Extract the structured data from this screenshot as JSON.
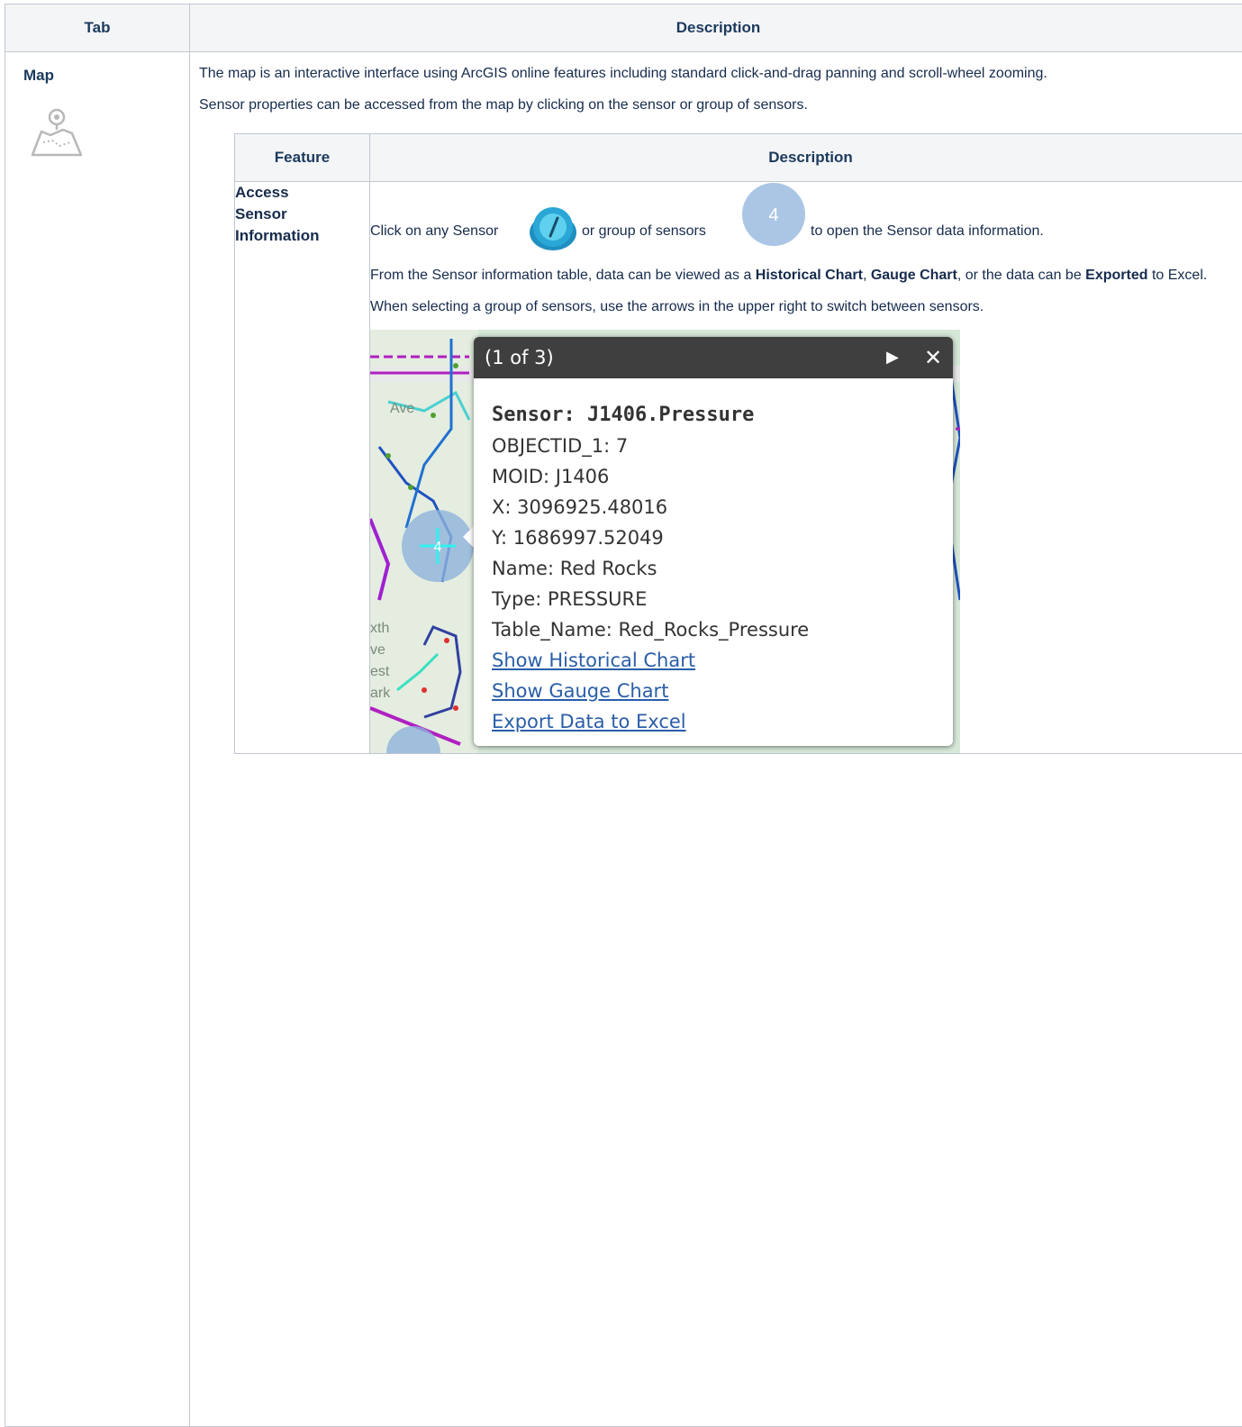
{
  "outer_table": {
    "headers": [
      "Tab",
      "Description"
    ],
    "tab_name": "Map",
    "tab_icon": "map-pin-icon",
    "p1": "The map is an interactive interface using ArcGIS online features including standard click-and-drag panning and scroll-wheel zooming.",
    "p2": "Sensor properties can be accessed from the map by clicking on the sensor or group of sensors."
  },
  "inner_table": {
    "headers": [
      "Feature",
      "Description"
    ],
    "feature_label": "Access Sensor Information",
    "click_line": {
      "part1": "Click on any Sensor",
      "part2": "or group of sensors",
      "part3": "to open the Sensor data information."
    },
    "cluster_count": "4",
    "s2": {
      "a": "From the Sensor information table, data can be viewed as a ",
      "b1": "Historical Chart",
      "c": ", ",
      "b2": "Gauge Chart",
      "d": ", or the data can be ",
      "b3": "Exported",
      "e": " to Excel."
    },
    "s3": "When selecting a group of sensors, use the arrows in the upper right to switch between sensors."
  },
  "popup": {
    "title": "(1 of 3)",
    "next_icon": "play-arrow-icon",
    "close_icon": "close-icon",
    "sensor_title": "Sensor: J1406.Pressure",
    "fields": [
      "OBJECTID_1: 7",
      "MOID: J1406",
      "X: 3096925.48016",
      "Y: 1686997.52049",
      "Name: Red Rocks",
      "Type: PRESSURE",
      "Table_Name: Red_Rocks_Pressure"
    ],
    "links": [
      "Show Historical Chart",
      "Show Gauge Chart",
      "Export Data to Excel"
    ]
  },
  "map_labels": {
    "cluster_count": "4",
    "street_fragments": [
      "Ave",
      "xth",
      "ve",
      "est",
      "ark"
    ]
  },
  "colors": {
    "header_bg": "#f4f5f7",
    "header_text": "#1b3a5c",
    "border": "#c1c7d0",
    "link": "#2a5ea8",
    "popup_header": "#3f3f3f",
    "cluster": "#8fb3dc"
  }
}
